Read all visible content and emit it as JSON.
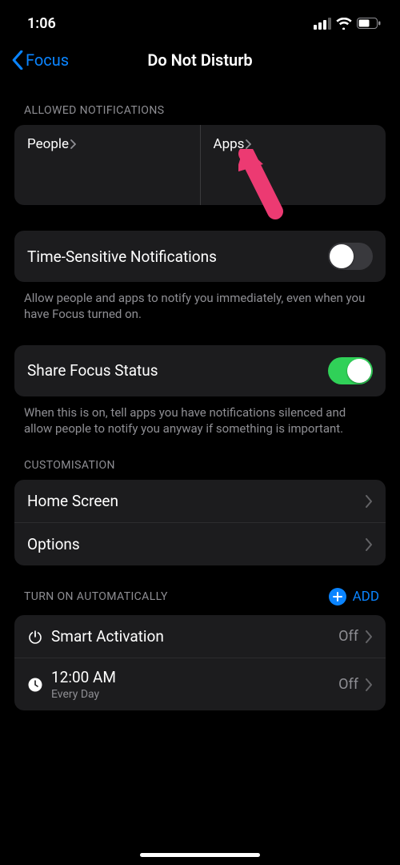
{
  "status": {
    "time": "1:06"
  },
  "nav": {
    "back": "Focus",
    "title": "Do Not Disturb"
  },
  "allowed": {
    "header": "Allowed Notifications",
    "people": "People",
    "apps": "Apps"
  },
  "timeSensitive": {
    "label": "Time-Sensitive Notifications",
    "on": false,
    "footer": "Allow people and apps to notify you immediately, even when you have Focus turned on."
  },
  "share": {
    "label": "Share Focus Status",
    "on": true,
    "footer": "When this is on, tell apps you have notifications silenced and allow people to notify you anyway if something is important."
  },
  "custom": {
    "header": "Customisation",
    "home": "Home Screen",
    "options": "Options"
  },
  "auto": {
    "header": "Turn On Automatically",
    "add": "ADD",
    "smart": {
      "label": "Smart Activation",
      "value": "Off"
    },
    "schedule": {
      "time": "12:00 AM",
      "repeat": "Every Day",
      "value": "Off"
    }
  }
}
